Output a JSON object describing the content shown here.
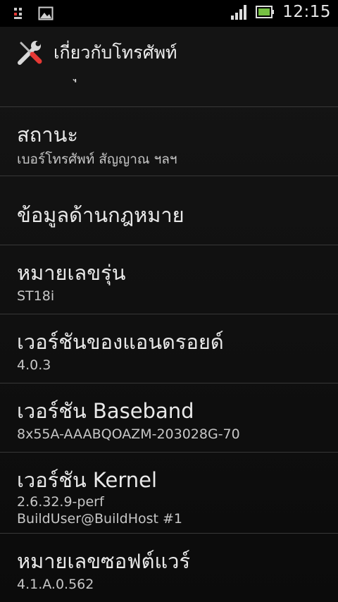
{
  "status_bar": {
    "left_icons": [
      "usb-debug-icon",
      "image-icon"
    ],
    "right_icons": [
      "signal-icon",
      "battery-icon"
    ],
    "time": "12:15"
  },
  "header": {
    "icon": "tools-icon",
    "title": "เกี่ยวกับโทรศัพท์"
  },
  "list": {
    "partial_top": "ปรับปรุงระบบ",
    "items": [
      {
        "title": "สถานะ",
        "summary": "เบอร์โทรศัพท์ สัญญาณ ฯลฯ"
      },
      {
        "title": "ข้อมูลด้านกฎหมาย",
        "summary": ""
      },
      {
        "title": "หมายเลขรุ่น",
        "summary": "ST18i"
      },
      {
        "title": "เวอร์ชันของแอนดรอยด์",
        "summary": "4.0.3"
      },
      {
        "title": "เวอร์ชัน Baseband",
        "summary": "8x55A-AAABQOAZM-203028G-70"
      },
      {
        "title": "เวอร์ชัน Kernel",
        "summary": "2.6.32.9-perf\nBuildUser@BuildHost #1"
      },
      {
        "title": "หมายเลขซอฟต์แวร์",
        "summary": "4.1.A.0.562"
      }
    ]
  }
}
